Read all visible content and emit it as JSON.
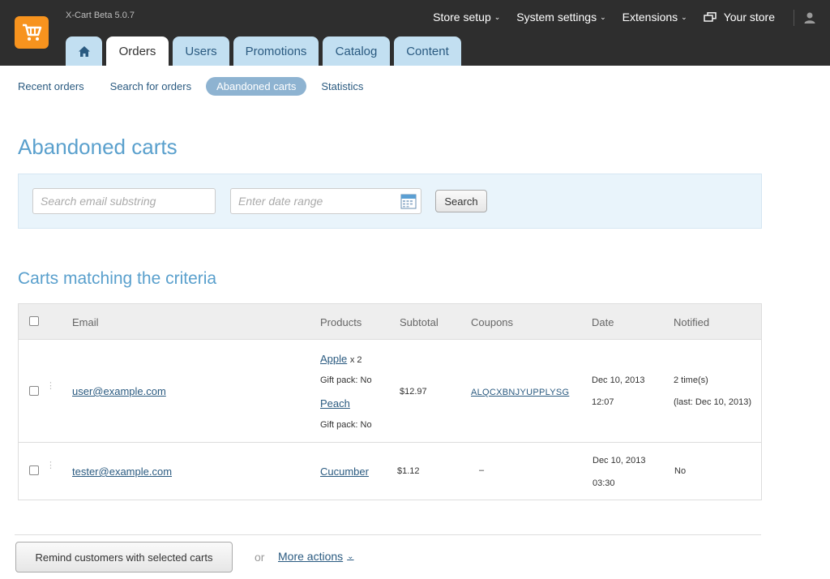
{
  "app": {
    "version": "X-Cart Beta 5.0.7"
  },
  "topnav": {
    "store_setup": "Store setup",
    "system_settings": "System settings",
    "extensions": "Extensions",
    "your_store": "Your store"
  },
  "tabs": [
    {
      "label": "Orders"
    },
    {
      "label": "Users"
    },
    {
      "label": "Promotions"
    },
    {
      "label": "Catalog"
    },
    {
      "label": "Content"
    }
  ],
  "subnav": {
    "recent_orders": "Recent orders",
    "search_orders": "Search for orders",
    "abandoned_carts": "Abandoned carts",
    "statistics": "Statistics"
  },
  "page_title": "Abandoned carts",
  "search": {
    "email_placeholder": "Search email substring",
    "date_placeholder": "Enter date range",
    "button": "Search"
  },
  "section_title": "Carts matching the criteria",
  "table": {
    "headers": {
      "email": "Email",
      "products": "Products",
      "subtotal": "Subtotal",
      "coupons": "Coupons",
      "date": "Date",
      "notified": "Notified"
    },
    "rows": [
      {
        "email": "user@example.com",
        "products": [
          {
            "name": "Apple",
            "qty": "x 2",
            "option": "Gift pack: No"
          },
          {
            "name": "Peach",
            "option": "Gift pack: No"
          }
        ],
        "subtotal": "$12.97",
        "coupon": "ALQCXBNJYUPPLYSG",
        "date": "Dec 10, 2013",
        "time": "12:07",
        "notified": "2 time(s)",
        "notified_last": "(last: Dec 10, 2013)"
      },
      {
        "email": "tester@example.com",
        "products": [
          {
            "name": "Cucumber"
          }
        ],
        "subtotal": "$1.12",
        "coupon": "–",
        "date": "Dec 10, 2013",
        "time": "03:30",
        "notified": "No"
      }
    ]
  },
  "footer": {
    "remind_button": "Remind customers with selected carts",
    "or": "or",
    "more_actions": "More actions"
  },
  "colors": {
    "accent": "#5aa0cd",
    "topbar": "#2e2e2e",
    "tab": "#c2dff1",
    "logo": "#f7931e"
  }
}
